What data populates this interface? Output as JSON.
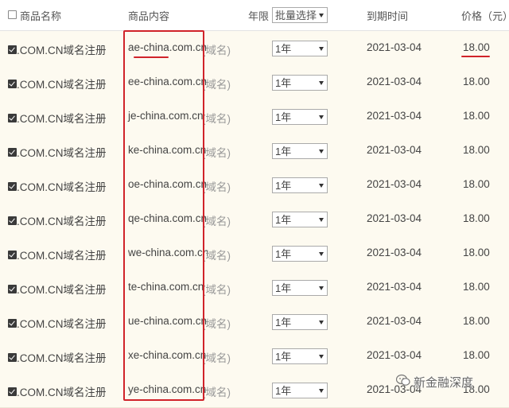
{
  "header": {
    "product_name": "商品名称",
    "product_content": "商品内容",
    "term": "年限",
    "batch_select": "批量选择",
    "expiry": "到期时间",
    "price": "价格（元）"
  },
  "rows": [
    {
      "name": ".COM.CN域名注册",
      "domain": "ae-china.com.cn",
      "suffix": "(域名)",
      "term": "1年",
      "expiry": "2021-03-04",
      "price": "18.00"
    },
    {
      "name": ".COM.CN域名注册",
      "domain": "ee-china.com.cn",
      "suffix": "(域名)",
      "term": "1年",
      "expiry": "2021-03-04",
      "price": "18.00"
    },
    {
      "name": ".COM.CN域名注册",
      "domain": "je-china.com.cn",
      "suffix": "(域名)",
      "term": "1年",
      "expiry": "2021-03-04",
      "price": "18.00"
    },
    {
      "name": ".COM.CN域名注册",
      "domain": "ke-china.com.cn",
      "suffix": "(域名)",
      "term": "1年",
      "expiry": "2021-03-04",
      "price": "18.00"
    },
    {
      "name": ".COM.CN域名注册",
      "domain": "oe-china.com.cn",
      "suffix": "(域名)",
      "term": "1年",
      "expiry": "2021-03-04",
      "price": "18.00"
    },
    {
      "name": ".COM.CN域名注册",
      "domain": "qe-china.com.cn",
      "suffix": "(域名)",
      "term": "1年",
      "expiry": "2021-03-04",
      "price": "18.00"
    },
    {
      "name": ".COM.CN域名注册",
      "domain": "we-china.com.cn",
      "suffix": "(域名)",
      "term": "1年",
      "expiry": "2021-03-04",
      "price": "18.00"
    },
    {
      "name": ".COM.CN域名注册",
      "domain": "te-china.com.cn",
      "suffix": "(域名)",
      "term": "1年",
      "expiry": "2021-03-04",
      "price": "18.00"
    },
    {
      "name": ".COM.CN域名注册",
      "domain": "ue-china.com.cn",
      "suffix": "(域名)",
      "term": "1年",
      "expiry": "2021-03-04",
      "price": "18.00"
    },
    {
      "name": ".COM.CN域名注册",
      "domain": "xe-china.com.cn",
      "suffix": "(域名)",
      "term": "1年",
      "expiry": "2021-03-04",
      "price": "18.00"
    },
    {
      "name": ".COM.CN域名注册",
      "domain": "ye-china.com.cn",
      "suffix": "(域名)",
      "term": "1年",
      "expiry": "2021-03-04",
      "price": "18.00"
    }
  ],
  "watermark": "新金融深度",
  "colors": {
    "annotation_red": "#d0232a",
    "row_bg": "#fdfaf0"
  }
}
